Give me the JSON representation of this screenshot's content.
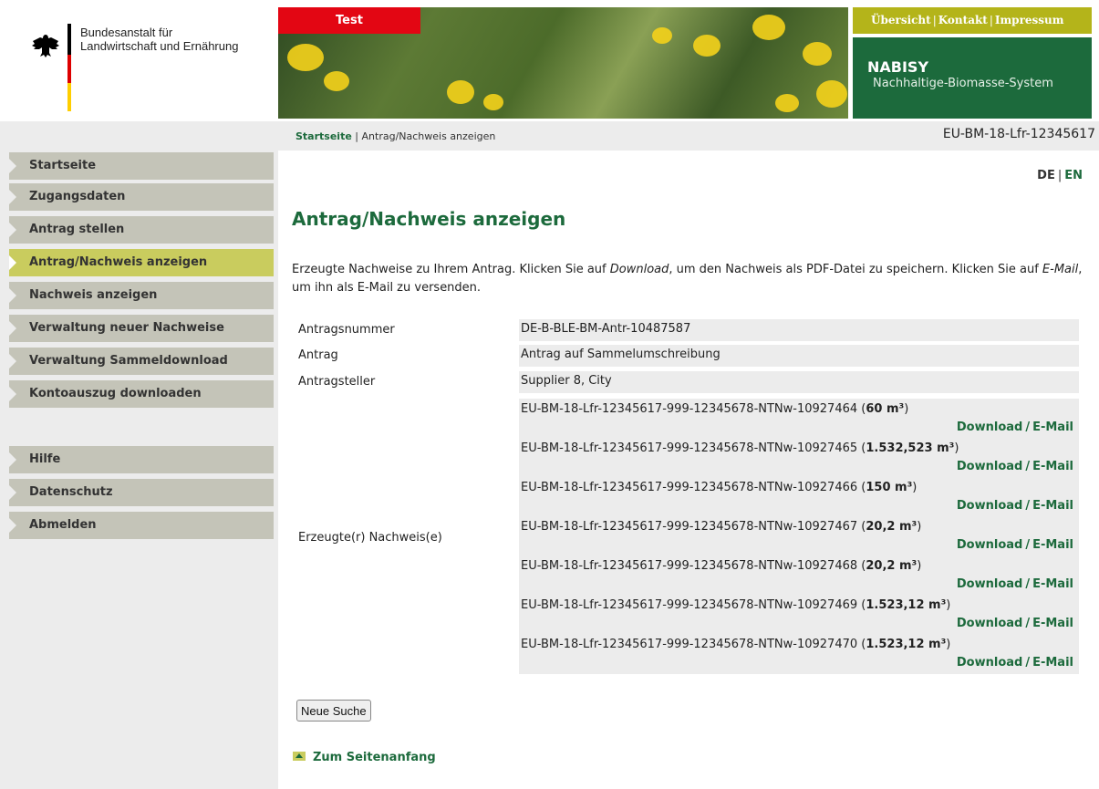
{
  "header": {
    "org_name_line1": "Bundesanstalt für",
    "org_name_line2": "Landwirtschaft und Ernährung",
    "test_tag": "Test",
    "topnav": [
      "Übersicht",
      "Kontakt",
      "Impressum"
    ],
    "system_title": "NABISY",
    "system_subtitle": "Nachhaltige-Biomasse-System"
  },
  "breadcrumb": {
    "home": "Startseite",
    "separator": "|",
    "current": "Antrag/Nachweis anzeigen"
  },
  "account_id": "EU-BM-18-Lfr-12345617",
  "sidebar": {
    "items": [
      {
        "label": "Startseite"
      },
      {
        "label": "Zugangsdaten"
      },
      {
        "label": "Antrag stellen"
      },
      {
        "label": "Antrag/Nachweis anzeigen",
        "active": true
      },
      {
        "label": "Nachweis anzeigen"
      },
      {
        "label": "Verwaltung neuer Nachweise"
      },
      {
        "label": "Verwaltung Sammeldownload"
      },
      {
        "label": "Kontoauszug downloaden"
      }
    ],
    "bottom_items": [
      {
        "label": "Hilfe"
      },
      {
        "label": "Datenschutz"
      },
      {
        "label": "Abmelden"
      }
    ]
  },
  "language": {
    "de": "DE",
    "separator": "|",
    "en": "EN"
  },
  "main": {
    "title": "Antrag/Nachweis anzeigen",
    "intro_1": "Erzeugte Nachweise zu Ihrem Antrag. Klicken Sie auf ",
    "intro_download": "Download",
    "intro_2": ", um den Nachweis als PDF-Datei zu speichern. Klicken Sie auf ",
    "intro_email": "E-Mail",
    "intro_3": ", um ihn als E-Mail zu versenden.",
    "fields": [
      {
        "label": "Antragsnummer",
        "value": "DE-B-BLE-BM-Antr-10487587"
      },
      {
        "label": "Antrag",
        "value": "Antrag auf Sammelumschreibung"
      },
      {
        "label": "Antragsteller",
        "value": "Supplier 8, City"
      }
    ],
    "certs_label": "Erzeugte(r) Nachweis(e)",
    "certificates": [
      {
        "id": "EU-BM-18-Lfr-12345617-999-12345678-NTNw-10927464",
        "amount": "60 m³"
      },
      {
        "id": "EU-BM-18-Lfr-12345617-999-12345678-NTNw-10927465",
        "amount": "1.532,523 m³"
      },
      {
        "id": "EU-BM-18-Lfr-12345617-999-12345678-NTNw-10927466",
        "amount": "150 m³"
      },
      {
        "id": "EU-BM-18-Lfr-12345617-999-12345678-NTNw-10927467",
        "amount": "20,2 m³"
      },
      {
        "id": "EU-BM-18-Lfr-12345617-999-12345678-NTNw-10927468",
        "amount": "20,2 m³"
      },
      {
        "id": "EU-BM-18-Lfr-12345617-999-12345678-NTNw-10927469",
        "amount": "1.523,12 m³"
      },
      {
        "id": "EU-BM-18-Lfr-12345617-999-12345678-NTNw-10927470",
        "amount": "1.523,12 m³"
      }
    ],
    "download_label": "Download",
    "action_separator": "/",
    "email_label": "E-Mail",
    "new_search_button": "Neue Suche",
    "to_top_link": "Zum Seitenanfang"
  },
  "colors": {
    "brand_green": "#1c6a3c",
    "topnav_olive": "#b4b41a",
    "test_red": "#e30613",
    "nav_gray": "#c4c4b8",
    "nav_active": "#c9cc5e"
  }
}
